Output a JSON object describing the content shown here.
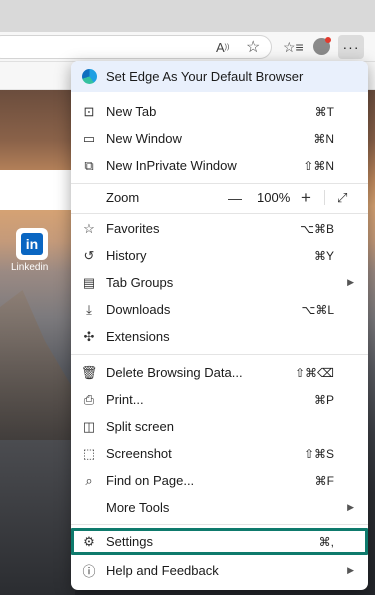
{
  "browser": {
    "read_aloud_icon": "read-aloud-icon",
    "favorite_icon": "star-icon",
    "collections_icon": "collections-icon",
    "more_label": "···"
  },
  "page": {
    "tile_label": "Linkedin",
    "tile_logo": "in"
  },
  "menu": {
    "default_browser": "Set Edge As Your Default Browser",
    "new_tab": {
      "label": "New Tab",
      "shortcut": "⌘T"
    },
    "new_window": {
      "label": "New Window",
      "shortcut": "⌘N"
    },
    "new_inprivate": {
      "label": "New InPrivate Window",
      "shortcut": "⇧⌘N"
    },
    "zoom": {
      "label": "Zoom",
      "minus": "—",
      "value": "100%",
      "plus": "+"
    },
    "favorites": {
      "label": "Favorites",
      "shortcut": "⌥⌘B"
    },
    "history": {
      "label": "History",
      "shortcut": "⌘Y"
    },
    "tab_groups": {
      "label": "Tab Groups"
    },
    "downloads": {
      "label": "Downloads",
      "shortcut": "⌥⌘L"
    },
    "extensions": {
      "label": "Extensions"
    },
    "delete_data": {
      "label": "Delete Browsing Data...",
      "shortcut": "⇧⌘⌫"
    },
    "print": {
      "label": "Print...",
      "shortcut": "⌘P"
    },
    "split_screen": {
      "label": "Split screen"
    },
    "screenshot": {
      "label": "Screenshot",
      "shortcut": "⇧⌘S"
    },
    "find": {
      "label": "Find on Page...",
      "shortcut": "⌘F"
    },
    "more_tools": {
      "label": "More Tools"
    },
    "settings": {
      "label": "Settings",
      "shortcut": "⌘,"
    },
    "help": {
      "label": "Help and Feedback"
    }
  },
  "colors": {
    "highlight": "#0e7a6c",
    "edge_blue": "#1fa0e3",
    "linkedin": "#0a66c2"
  }
}
